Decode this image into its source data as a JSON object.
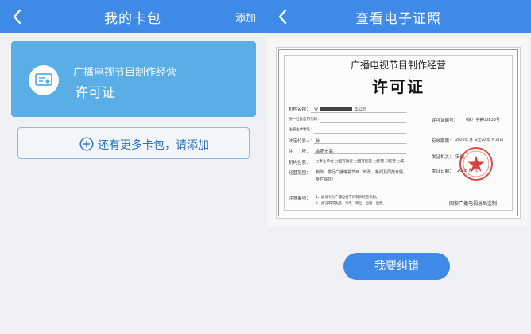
{
  "left": {
    "header": {
      "title": "我的卡包",
      "add_label": "添加"
    },
    "card": {
      "category": "广播电视节目制作经营",
      "name": "许可证"
    },
    "add_more_label": "还有更多卡包，请添加"
  },
  "right": {
    "header": {
      "title": "查看电子证照"
    },
    "certificate": {
      "title_line1": "广播电视节目制作经营",
      "title_line2": "许可证",
      "fields": {
        "org_name_label": "机构名称：",
        "org_name_prefix": "安",
        "org_name_suffix": "其公司",
        "credit_code_label": "统一社会信用代码：",
        "reg_address_label": "注册主体地址：",
        "legal_rep_label": "法定代表人：",
        "legal_rep_value": "孙",
        "address_label": "住　　所：",
        "address_value": "合肥市高",
        "org_nature_label": "机构性质：",
        "org_nature_options": "□事业单位 □国有独资 □国有控股 □民营 ☑民营 □其",
        "scope_label": "经营范围：",
        "scope_value": "制作、发行广播电视节目（时政、新闻及同类专题、",
        "scope_value2": "专栏除外）",
        "license_no_label": "许可证编号：",
        "license_no_value": "（皖）字第00833号",
        "valid_label": "有效期限：",
        "valid_value": "2020年 月 日至20 年 月31日",
        "issuer_label": "发证机关：",
        "issuer_value": "安徽",
        "issue_date_label": "发证日期：",
        "issue_date_value": "20 年 月 日",
        "notes_label": "注意事项：",
        "note1": "1、此证书为广播电视节目制作经营机构。",
        "note2": "2、此证不得伪造、涂改、转让、出租、出借。"
      },
      "issuing_org": "国家广播电视总局监制"
    },
    "report_label": "我要纠错"
  },
  "colors": {
    "header": "#3f8ae6",
    "card": "#5aaee6",
    "link": "#2d6fc2",
    "seal": "#d92a2a"
  },
  "icons": [
    "back-icon",
    "license-badge-icon",
    "plus-circle-icon",
    "seal-icon"
  ]
}
